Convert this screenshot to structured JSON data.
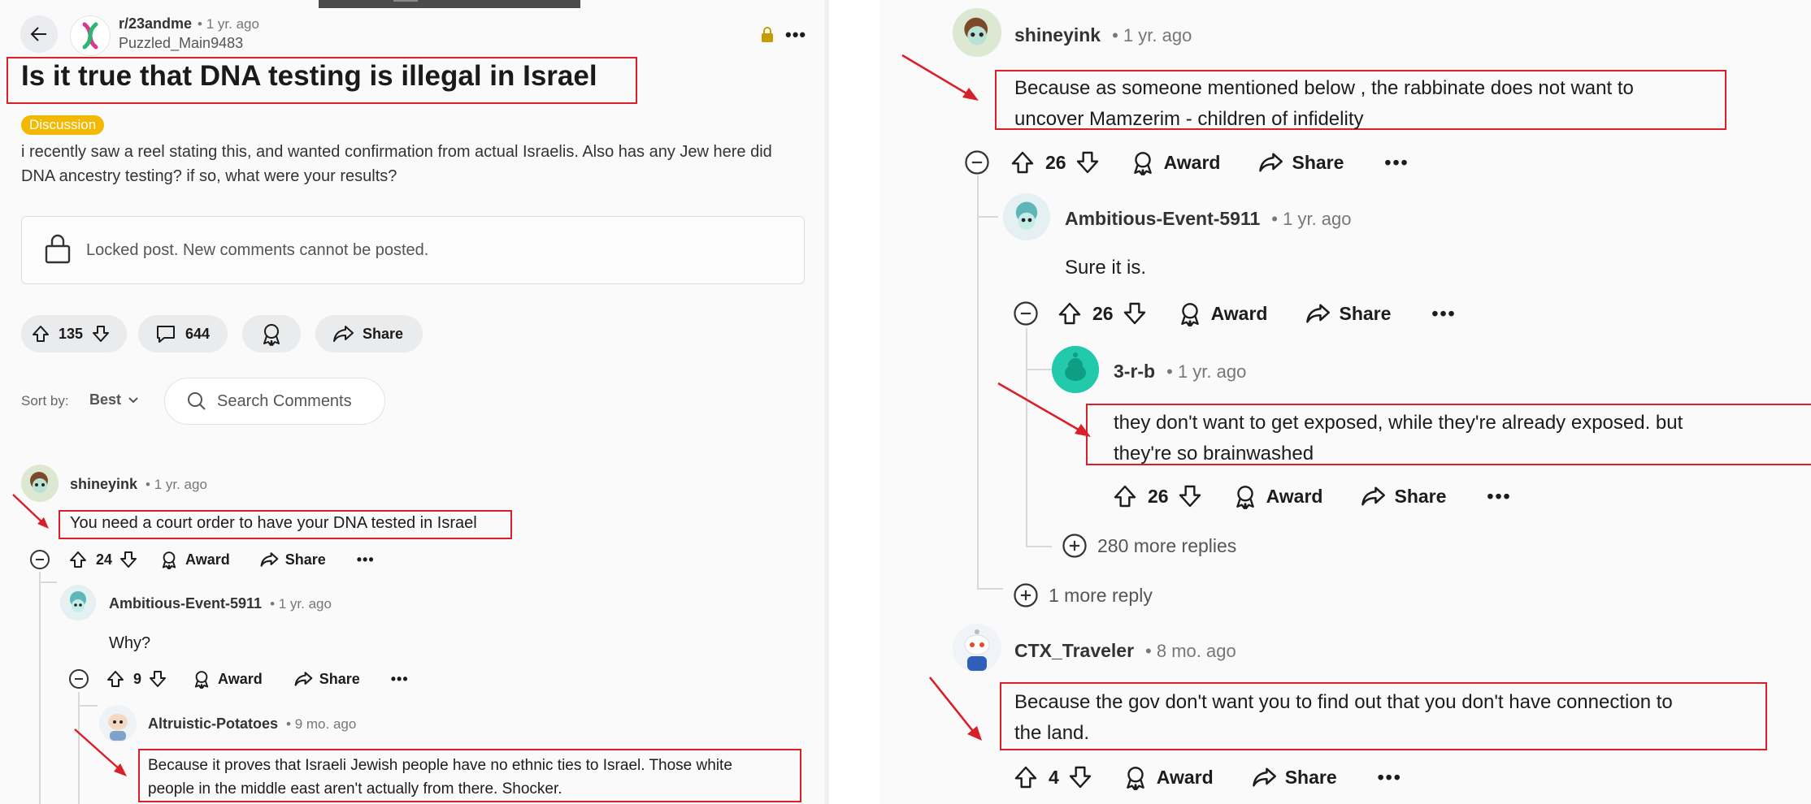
{
  "post": {
    "subreddit": "r/23andme",
    "age": "• 1 yr. ago",
    "author": "Puzzled_Main9483",
    "title": "Is it true that DNA testing is illegal in Israel",
    "flair": "Discussion",
    "body": "i recently saw a reel stating this, and wanted confirmation from actual Israelis. Also has any Jew here did DNA ancestry testing? if so, what were your results?",
    "locked_text": "Locked post. New comments cannot be posted.",
    "upvotes": "135",
    "comments": "644",
    "share_label": "Share"
  },
  "sort": {
    "label": "Sort by:",
    "value": "Best",
    "search_placeholder": "Search Comments"
  },
  "left_comments": [
    {
      "author": "shineyink",
      "age": "• 1 yr. ago",
      "text": "You need a court order to have your DNA tested in Israel",
      "votes": "24"
    },
    {
      "author": "Ambitious-Event-5911",
      "age": "• 1 yr. ago",
      "text": "Why?",
      "votes": "9"
    },
    {
      "author": "Altruistic-Potatoes",
      "age": "• 9 mo. ago",
      "text_line1": "Because it proves that Israeli Jewish people have no ethnic ties to Israel. Those white",
      "text_line2": "people in the middle east aren't actually from there. Shocker."
    }
  ],
  "right_comments": [
    {
      "author": "shineyink",
      "age": "• 1 yr. ago",
      "text_line1": "Because as someone mentioned below , the rabbinate does not want to",
      "text_line2": "uncover Mamzerim - children of infidelity",
      "votes": "26"
    },
    {
      "author": "Ambitious-Event-5911",
      "age": "• 1 yr. ago",
      "text": "Sure it is.",
      "votes": "26"
    },
    {
      "author": "3-r-b",
      "age": "• 1 yr. ago",
      "text_line1": "they don't want to get exposed, while they're already exposed. but",
      "text_line2": "they're so brainwashed",
      "votes": "26"
    },
    {
      "author": "CTX_Traveler",
      "age": "• 8 mo. ago",
      "text_line1": "Because the gov don't want you to find out that you don't have connection to",
      "text_line2": "the land.",
      "votes": "4"
    }
  ],
  "more_replies": {
    "deep": "280 more replies",
    "shallow": "1 more reply"
  },
  "actions": {
    "award": "Award",
    "share": "Share"
  },
  "colors": {
    "annotation_red": "#d7202a",
    "flair": "#f5b800",
    "lock": "#c89b00"
  }
}
